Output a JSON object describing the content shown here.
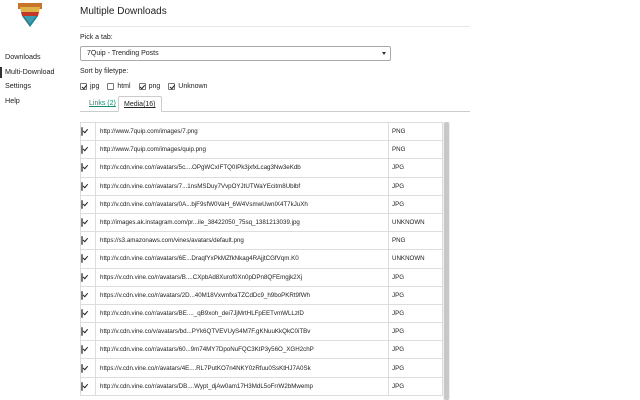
{
  "app": {
    "logo_icon": "download-arrow-icon"
  },
  "sidebar": {
    "items": [
      {
        "label": "Downloads",
        "active": false
      },
      {
        "label": "Multi-Download",
        "active": true
      },
      {
        "label": "Settings",
        "active": false
      },
      {
        "label": "Help",
        "active": false
      }
    ]
  },
  "main": {
    "title": "Multiple Downloads",
    "pick_label": "Pick a tab:",
    "tab_select": {
      "value": "7Quip - Trending Posts"
    },
    "sort_label": "Sort by filetype:",
    "filters": [
      {
        "label": "jpg",
        "checked": true
      },
      {
        "label": "html",
        "checked": false
      },
      {
        "label": "png",
        "checked": true
      },
      {
        "label": "Unknown",
        "checked": true
      }
    ],
    "tabs": {
      "links": "Links (2)",
      "media": "Media(16)"
    },
    "rows": [
      {
        "checked": true,
        "url": "http://www.7quip.com/images/7.png",
        "type": "PNG"
      },
      {
        "checked": true,
        "url": "http://www.7quip.com/images/quip.png",
        "type": "PNG"
      },
      {
        "checked": true,
        "url": "http://v.cdn.vine.co/r/avatars/5c....OPgWCxIFTQ0IPk3jxfxLcag3Nw3eKdb",
        "type": "JPG"
      },
      {
        "checked": true,
        "url": "http://v.cdn.vine.co/r/avatars/7...1nsMSDuy7VvpOYJtUTWaYEcitm8Ublbf",
        "type": "JPG"
      },
      {
        "checked": true,
        "url": "http://v.cdn.vine.co/r/avatars/0A...bjF9sfW0VaH_6W4VsmwUwnlX4T7kJuXh",
        "type": "JPG"
      },
      {
        "checked": true,
        "url": "http://images.ak.instagram.com/pr...ile_38422050_75sq_1381213039.jpg",
        "type": "UNKNOWN"
      },
      {
        "checked": true,
        "url": "https://s3.amazonaws.com/vines/avatars/default.png",
        "type": "PNG"
      },
      {
        "checked": true,
        "url": "http://v.cdn.vine.co/r/avatars/6E...DraqfYxPkMZfkNkag4RAjjtCGfVqm.K0",
        "type": "UNKNOWN"
      },
      {
        "checked": true,
        "url": "https://v.cdn.vine.co/r/avatars/B....CXpbAd8Xurof0Xn0pDPn8QFEmgjk2Xj",
        "type": "JPG"
      },
      {
        "checked": true,
        "url": "https://v.cdn.vine.co/r/avatars/2D...40M18VxvmfxaTZCdDc9_h9boPKRt9fWh",
        "type": "JPG"
      },
      {
        "checked": true,
        "url": "http://v.cdn.vine.co/r/avatars/BE...._qB9xoh_dei7JjMrtHLFpEETvmWLLzlD",
        "type": "JPG"
      },
      {
        "checked": true,
        "url": "http://v.cdn.vine.co/v/avatars/bd...PYk6QTVEVUyS4M7F.gKNuuKkQkC0iTBv",
        "type": "JPG"
      },
      {
        "checked": true,
        "url": "http://v.cdn.vine.co/r/avatars/60...9m74MY7DpoNuFQC3KtP3y56O_XGH2chP",
        "type": "JPG"
      },
      {
        "checked": true,
        "url": "https://v.cdn.vine.co/r/avatars/4E....RL7PutKO7n4NKY0zRfuu0SsKtHJ7A0Sk",
        "type": "JPG"
      },
      {
        "checked": true,
        "url": "http://v.cdn.vine.co/r/avatars/DB....Wypt_djAw0am17H3MdL5oFrrW2bMwemp",
        "type": "JPG"
      }
    ]
  }
}
